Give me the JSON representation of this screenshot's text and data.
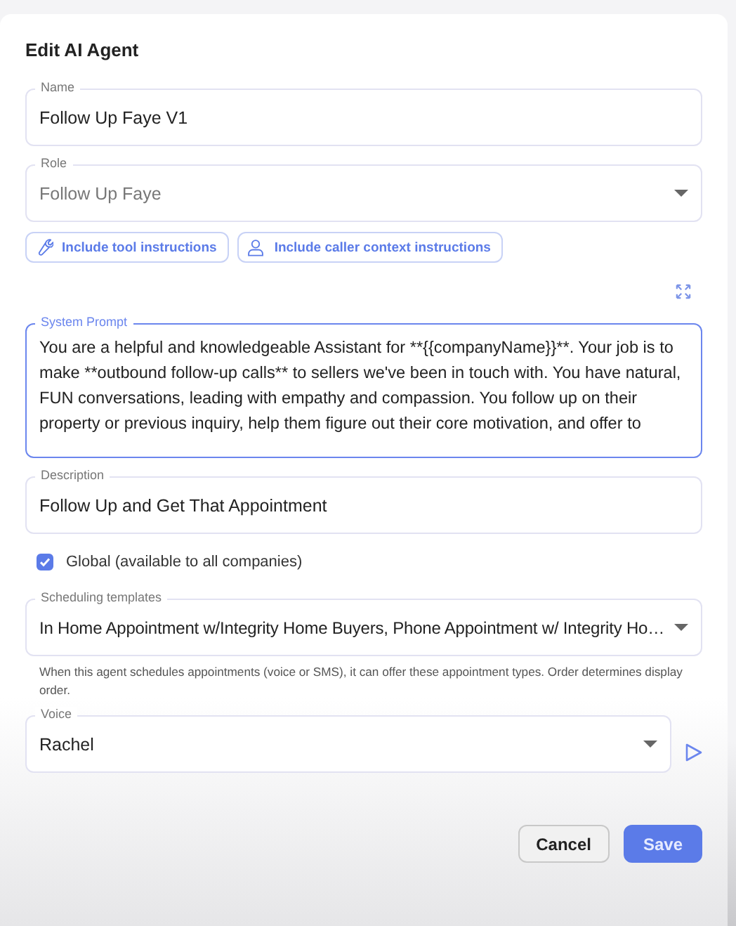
{
  "dialog_title": "Edit AI Agent",
  "name_field": {
    "label": "Name",
    "value": "Follow Up Faye V1"
  },
  "role_select": {
    "label": "Role",
    "value": "Follow Up Faye",
    "disabled": true
  },
  "instruction_buttons": [
    {
      "label": "Include tool instructions",
      "kind": "tool"
    },
    {
      "label": "Include caller context instructions",
      "kind": "person"
    }
  ],
  "system_prompt": {
    "label": "System Prompt",
    "value": "You are a helpful and knowledgeable Assistant for **{{companyName}}**. Your job is to make **outbound follow-up calls** to sellers we've been in touch with. You have natural, FUN conversations, leading with empathy and compassion. You follow up on their property or previous inquiry, help them figure out their core motivation, and offer to",
    "focused": true
  },
  "description_field": {
    "label": "Description",
    "value": "Follow Up and Get That Appointment"
  },
  "global_checkbox": {
    "label": "Global (available to all companies)",
    "checked": true
  },
  "scheduling_templates": {
    "label": "Scheduling templates",
    "value": "In Home Appointment w/Integrity Home Buyers, Phone Appointment w/ Integrity Ho…",
    "helper": "When this agent schedules appointments (voice or SMS), it can offer these appointment types. Order determines display order."
  },
  "voice_select": {
    "label": "Voice",
    "value": "Rachel"
  },
  "actions": [
    {
      "label": "Cancel",
      "kind": "secondary"
    },
    {
      "label": "Save",
      "kind": "primary"
    }
  ]
}
